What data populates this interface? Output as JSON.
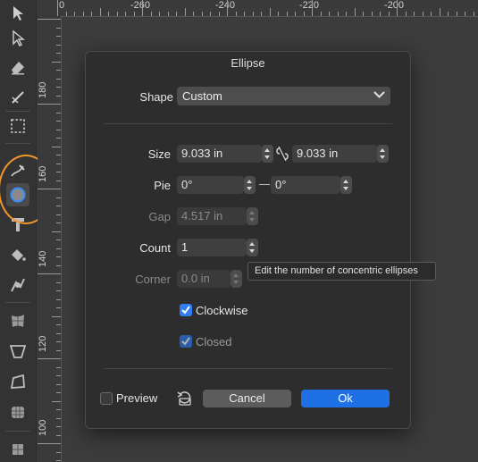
{
  "ruler_top": {
    "labels": [
      "0",
      "-260",
      "-240",
      "-220",
      "-200"
    ]
  },
  "ruler_left": {
    "labels": [
      "180",
      "160",
      "140",
      "120",
      "100"
    ]
  },
  "toolbar": {
    "tools": [
      "move-icon",
      "node-icon",
      "eraser-icon",
      "knife-icon",
      "marquee-select-icon",
      "pencil-icon",
      "ellipse-icon",
      "text-icon",
      "fill-icon",
      "transparency-icon",
      "mesh-warp-icon",
      "perspective-icon",
      "envelope-icon",
      "shape-builder-icon",
      "crop-icon"
    ],
    "selected": "ellipse-icon"
  },
  "dialog": {
    "title": "Ellipse",
    "shape": {
      "label": "Shape",
      "value": "Custom"
    },
    "size": {
      "label": "Size",
      "width": "9.033 in",
      "height": "9.033 in"
    },
    "pie": {
      "label": "Pie",
      "start": "0°",
      "end": "0°"
    },
    "gap": {
      "label": "Gap",
      "value": "4.517 in"
    },
    "count": {
      "label": "Count",
      "value": "1"
    },
    "corner": {
      "label": "Corner",
      "value": "0.0 in"
    },
    "clockwise": {
      "label": "Clockwise",
      "checked": true
    },
    "closed": {
      "label": "Closed",
      "checked": true
    },
    "preview": {
      "label": "Preview",
      "checked": false
    },
    "cancel_label": "Cancel",
    "ok_label": "Ok"
  },
  "tooltip": {
    "text": "Edit the number of concentric ellipses"
  },
  "colors": {
    "accent": "#1f6fe5",
    "highlight_ring": "#f0962c",
    "checkbox": "#2f7ef5"
  }
}
